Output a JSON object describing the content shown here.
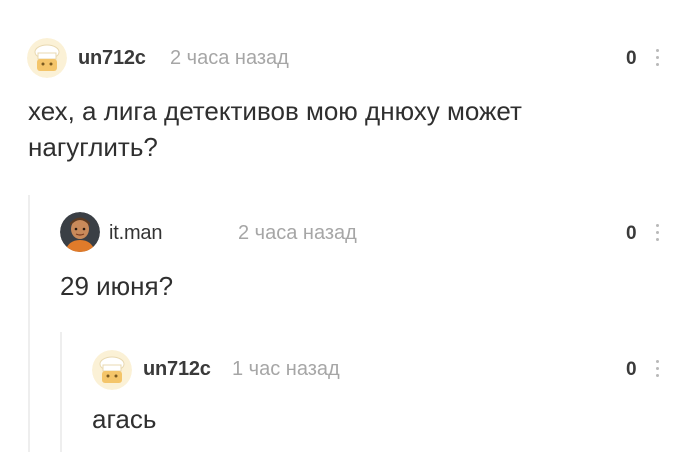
{
  "comments": [
    {
      "username": "un712c",
      "time": "2 часа назад",
      "rating": "0",
      "text": "хех, а лига детективов мою днюху может нагуглить?",
      "avatar": "chef-avatar"
    },
    {
      "username": "it.man",
      "time": "2 часа назад",
      "rating": "0",
      "text": "29 июня?",
      "avatar": "person-photo-avatar"
    },
    {
      "username": "un712c",
      "time": "1 час назад",
      "rating": "0",
      "text": "агась",
      "avatar": "chef-avatar"
    }
  ],
  "colors": {
    "username": "#3a3a3a",
    "time": "#a6a6a6",
    "text": "#2f2f2f",
    "thread_line": "#eeeeee",
    "avatar_chef_bg": "#fbf1d6"
  }
}
